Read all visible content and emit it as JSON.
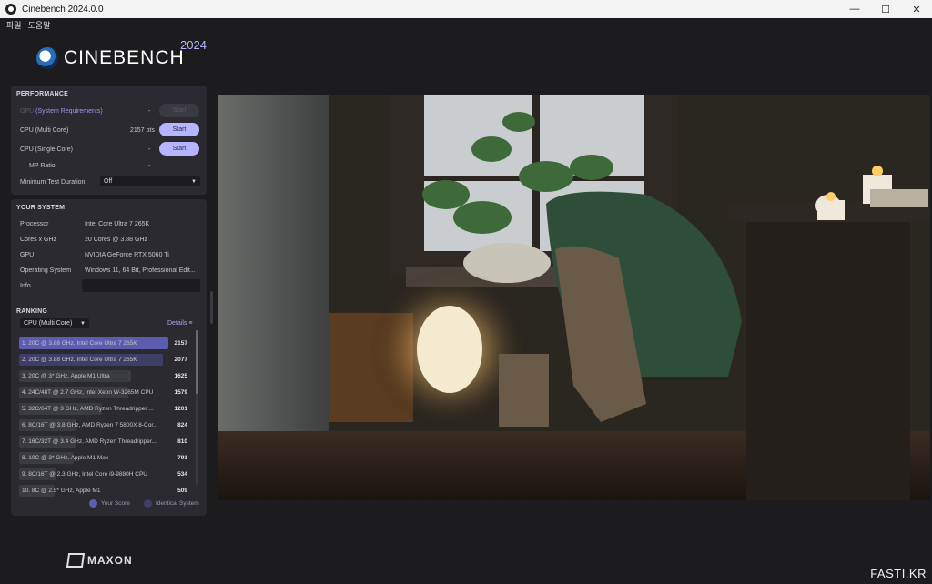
{
  "window": {
    "title": "Cinebench 2024.0.0",
    "minimize_icon": "—",
    "maximize_icon": "☐",
    "close_icon": "✕"
  },
  "menu": {
    "file": "파일",
    "help": "도움말"
  },
  "logo": {
    "word": "CINEBENCH",
    "year": "2024"
  },
  "performance": {
    "title": "PERFORMANCE",
    "gpu_label": "GPU",
    "gpu_req": "(System Requirements)",
    "gpu_value": "-",
    "gpu_button": "Start",
    "cpu_multi_label": "CPU (Multi Core)",
    "cpu_multi_value": "2157 pts",
    "cpu_multi_button": "Start",
    "cpu_single_label": "CPU (Single Core)",
    "cpu_single_value": "-",
    "cpu_single_button": "Start",
    "mp_ratio_label": "MP Ratio",
    "mp_ratio_value": "-",
    "min_duration_label": "Minimum Test Duration",
    "min_duration_value": "Off"
  },
  "system": {
    "title": "YOUR SYSTEM",
    "rows": [
      {
        "label": "Processor",
        "value": "Intel Core Ultra 7 265K"
      },
      {
        "label": "Cores x GHz",
        "value": "20 Cores @ 3.88 GHz"
      },
      {
        "label": "GPU",
        "value": "NVIDIA GeForce RTX 5060 Ti"
      },
      {
        "label": "Operating System",
        "value": "Windows 11, 64 Bit, Professional Edit..."
      },
      {
        "label": "Info",
        "value": ""
      }
    ]
  },
  "ranking": {
    "title": "RANKING",
    "selector": "CPU (Multi Core)",
    "details": "Details",
    "rows": [
      {
        "label": "1. 20C @ 3.88 GHz, Intel Core Ultra 7 265K",
        "score": "2157",
        "bar": 1.0,
        "kind": "yours"
      },
      {
        "label": "2. 20C @ 3.88 GHz, Intel Core Ultra 7 265K",
        "score": "2077",
        "bar": 0.963,
        "kind": "identical"
      },
      {
        "label": "3. 20C @ 3* GHz, Apple M1 Ultra",
        "score": "1625",
        "bar": 0.753,
        "kind": "other"
      },
      {
        "label": "4. 24C/48T @ 2.7 GHz, Intel Xeon W-3265M CPU",
        "score": "1579",
        "bar": 0.732,
        "kind": "other"
      },
      {
        "label": "5. 32C/64T @ 3 GHz, AMD Ryzen Threadripper ...",
        "score": "1201",
        "bar": 0.557,
        "kind": "other"
      },
      {
        "label": "6. 8C/16T @ 3.8 GHz, AMD Ryzen 7 5800X 8-Cor...",
        "score": "824",
        "bar": 0.382,
        "kind": "other"
      },
      {
        "label": "7. 16C/32T @ 3.4 GHz, AMD Ryzen Threadripper...",
        "score": "810",
        "bar": 0.376,
        "kind": "other"
      },
      {
        "label": "8. 10C @ 3* GHz, Apple M1 Max",
        "score": "791",
        "bar": 0.367,
        "kind": "other"
      },
      {
        "label": "9. 8C/16T @ 2.3 GHz, Intel Core i9-9880H CPU",
        "score": "534",
        "bar": 0.248,
        "kind": "other"
      },
      {
        "label": "10. 8C @ 2.5* GHz, Apple M1",
        "score": "509",
        "bar": 0.236,
        "kind": "other"
      }
    ],
    "legend_yours": "Your Score",
    "legend_identical": "Identical System"
  },
  "colors": {
    "yours": "#5c5cb0",
    "identical": "#3e3e66",
    "other": "#3b3b42",
    "accent": "#b5b5ff"
  },
  "footer": {
    "brand": "MAXON"
  },
  "watermark": "FASTI.KR"
}
